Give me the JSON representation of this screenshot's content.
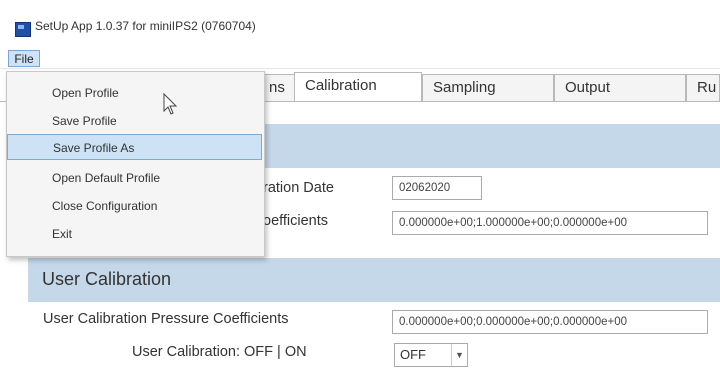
{
  "window": {
    "title": "SetUp App 1.0.37 for miniIPS2 (0760704)"
  },
  "menubar": {
    "file_label": "File"
  },
  "file_menu": {
    "items": [
      {
        "label": "Open Profile"
      },
      {
        "label": "Save Profile"
      },
      {
        "label": "Save Profile As"
      },
      {
        "label": "Open Default Profile"
      },
      {
        "label": "Close Configuration"
      },
      {
        "label": "Exit"
      }
    ],
    "hovered_item": "Save Profile As"
  },
  "tabs": [
    {
      "label": "ns"
    },
    {
      "label": "Calibration",
      "active": true
    },
    {
      "label": "Sampling"
    },
    {
      "label": "Output"
    },
    {
      "label": "Ru"
    }
  ],
  "factory_section": {
    "date_label": "ration Date",
    "date_value": "02062020",
    "coefficients_label": "oefficients",
    "coefficients_value": "0.000000e+00;1.000000e+00;0.000000e+00"
  },
  "user_section": {
    "title": "User Calibration",
    "pressure_label": "User Calibration Pressure Coefficients",
    "pressure_value": "0.000000e+00;0.000000e+00;0.000000e+00",
    "toggle_label": "User Calibration: OFF | ON",
    "toggle_value": "OFF"
  },
  "colors": {
    "section_header_bg": "#c4d8ea",
    "menu_hover_bg": "#cde3f5",
    "accent": "#1f4fa8"
  }
}
